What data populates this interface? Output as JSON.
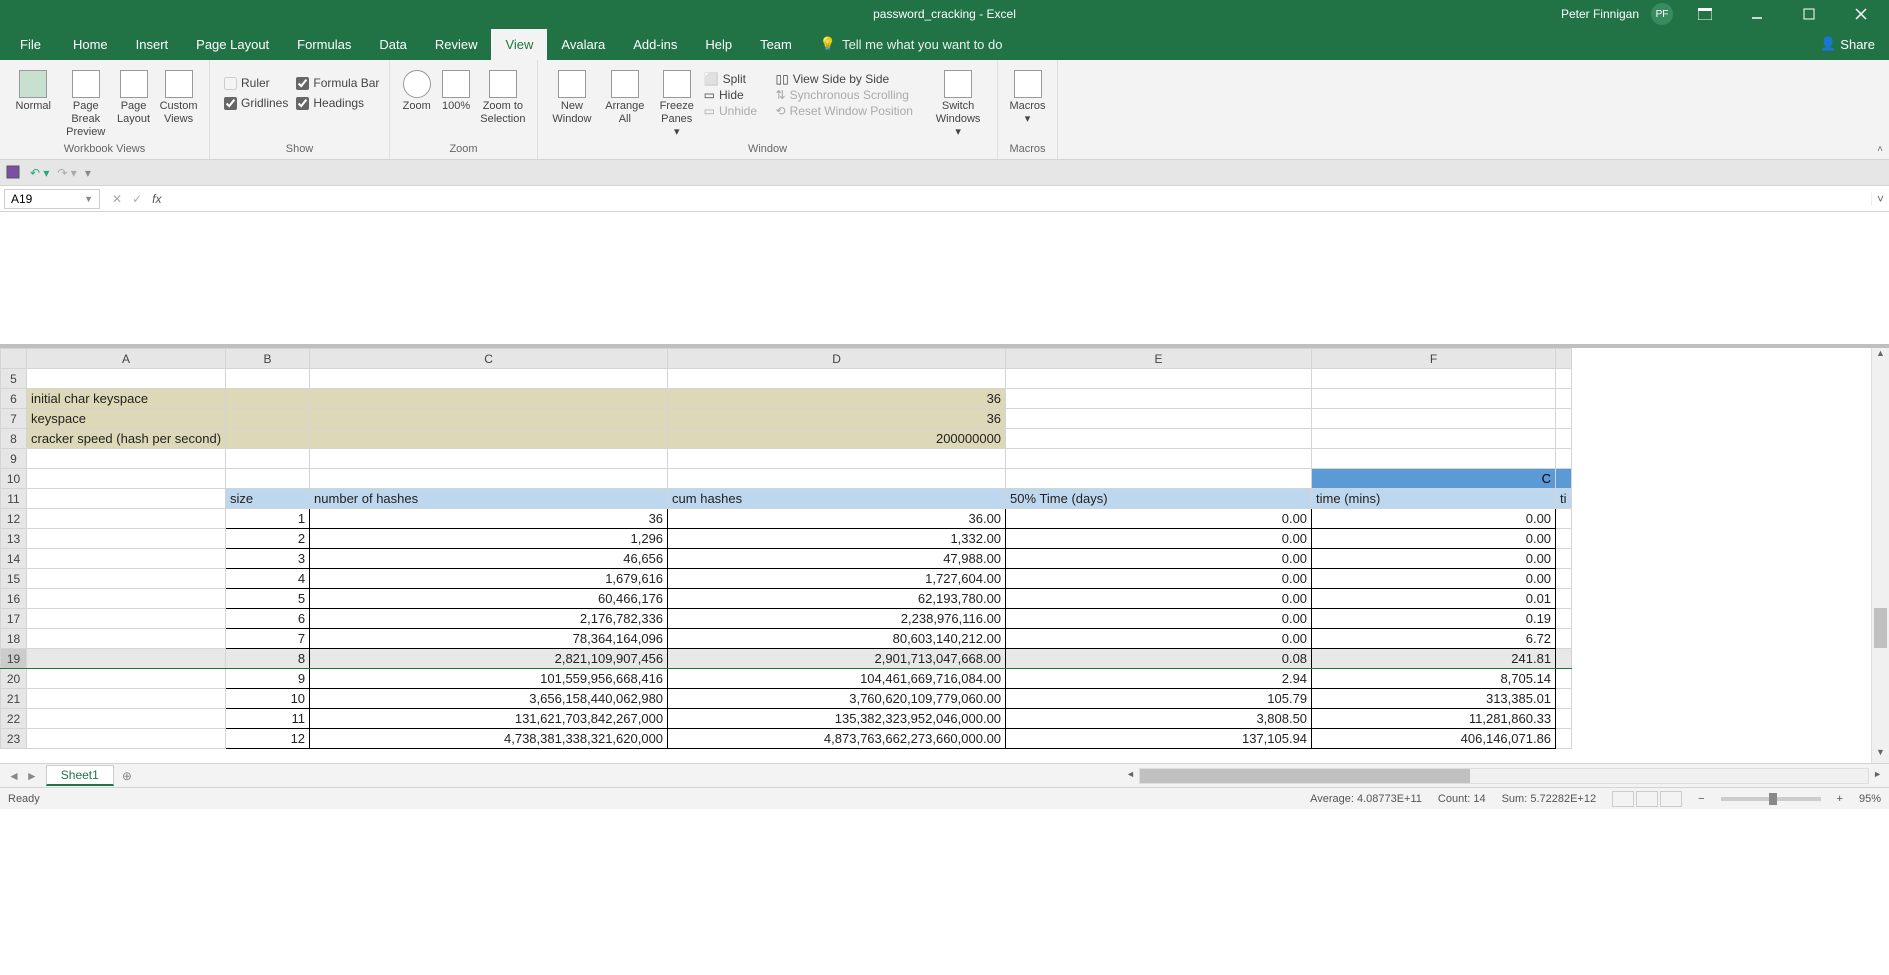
{
  "title": "password_cracking  -  Excel",
  "user": {
    "name": "Peter Finnigan",
    "initials": "PF"
  },
  "tabs": [
    "File",
    "Home",
    "Insert",
    "Page Layout",
    "Formulas",
    "Data",
    "Review",
    "View",
    "Avalara",
    "Add-ins",
    "Help",
    "Team"
  ],
  "activeTab": "View",
  "tellme": "Tell me what you want to do",
  "share": "Share",
  "ribbon": {
    "workbookViews": {
      "label": "Workbook Views",
      "normal": "Normal",
      "pageBreak": "Page Break Preview",
      "pageLayout": "Page Layout",
      "custom": "Custom Views"
    },
    "show": {
      "label": "Show",
      "ruler": "Ruler",
      "formulaBar": "Formula Bar",
      "gridlines": "Gridlines",
      "headings": "Headings"
    },
    "zoom": {
      "label": "Zoom",
      "zoom": "Zoom",
      "hundred": "100%",
      "selection": "Zoom to Selection"
    },
    "window": {
      "label": "Window",
      "newWin": "New Window",
      "arrange": "Arrange All",
      "freeze": "Freeze Panes",
      "split": "Split",
      "hide": "Hide",
      "unhide": "Unhide",
      "side": "View Side by Side",
      "sync": "Synchronous Scrolling",
      "reset": "Reset Window Position",
      "switch": "Switch Windows"
    },
    "macros": {
      "label": "Macros",
      "macros": "Macros"
    }
  },
  "namebox": "A19",
  "columns": [
    "A",
    "B",
    "C",
    "D",
    "E",
    "F"
  ],
  "labelRows": {
    "r6": {
      "a": "initial char keyspace",
      "d": "36"
    },
    "r7": {
      "a": "keyspace",
      "d": "36"
    },
    "r8": {
      "a": "cracker speed (hash per second)",
      "d": "200000000"
    }
  },
  "row10": {
    "f": "C"
  },
  "headers": {
    "b": "size",
    "c": "number of hashes",
    "d": "cum hashes",
    "e": "50% Time (days)",
    "f": "time (mins)",
    "g": "ti"
  },
  "dataRows": [
    {
      "n": 12,
      "b": "1",
      "c": "36",
      "d": "36.00",
      "e": "0.00",
      "f": "0.00"
    },
    {
      "n": 13,
      "b": "2",
      "c": "1,296",
      "d": "1,332.00",
      "e": "0.00",
      "f": "0.00"
    },
    {
      "n": 14,
      "b": "3",
      "c": "46,656",
      "d": "47,988.00",
      "e": "0.00",
      "f": "0.00"
    },
    {
      "n": 15,
      "b": "4",
      "c": "1,679,616",
      "d": "1,727,604.00",
      "e": "0.00",
      "f": "0.00"
    },
    {
      "n": 16,
      "b": "5",
      "c": "60,466,176",
      "d": "62,193,780.00",
      "e": "0.00",
      "f": "0.01"
    },
    {
      "n": 17,
      "b": "6",
      "c": "2,176,782,336",
      "d": "2,238,976,116.00",
      "e": "0.00",
      "f": "0.19"
    },
    {
      "n": 18,
      "b": "7",
      "c": "78,364,164,096",
      "d": "80,603,140,212.00",
      "e": "0.00",
      "f": "6.72"
    },
    {
      "n": 19,
      "b": "8",
      "c": "2,821,109,907,456",
      "d": "2,901,713,047,668.00",
      "e": "0.08",
      "f": "241.81"
    },
    {
      "n": 20,
      "b": "9",
      "c": "101,559,956,668,416",
      "d": "104,461,669,716,084.00",
      "e": "2.94",
      "f": "8,705.14"
    },
    {
      "n": 21,
      "b": "10",
      "c": "3,656,158,440,062,980",
      "d": "3,760,620,109,779,060.00",
      "e": "105.79",
      "f": "313,385.01"
    },
    {
      "n": 22,
      "b": "11",
      "c": "131,621,703,842,267,000",
      "d": "135,382,323,952,046,000.00",
      "e": "3,808.50",
      "f": "11,281,860.33"
    },
    {
      "n": 23,
      "b": "12",
      "c": "4,738,381,338,321,620,000",
      "d": "4,873,763,662,273,660,000.00",
      "e": "137,105.94",
      "f": "406,146,071.86"
    }
  ],
  "sheetTab": "Sheet1",
  "status": {
    "ready": "Ready",
    "avg": "Average: 4.08773E+11",
    "count": "Count: 14",
    "sum": "Sum: 5.72282E+12",
    "zoom": "95%"
  }
}
